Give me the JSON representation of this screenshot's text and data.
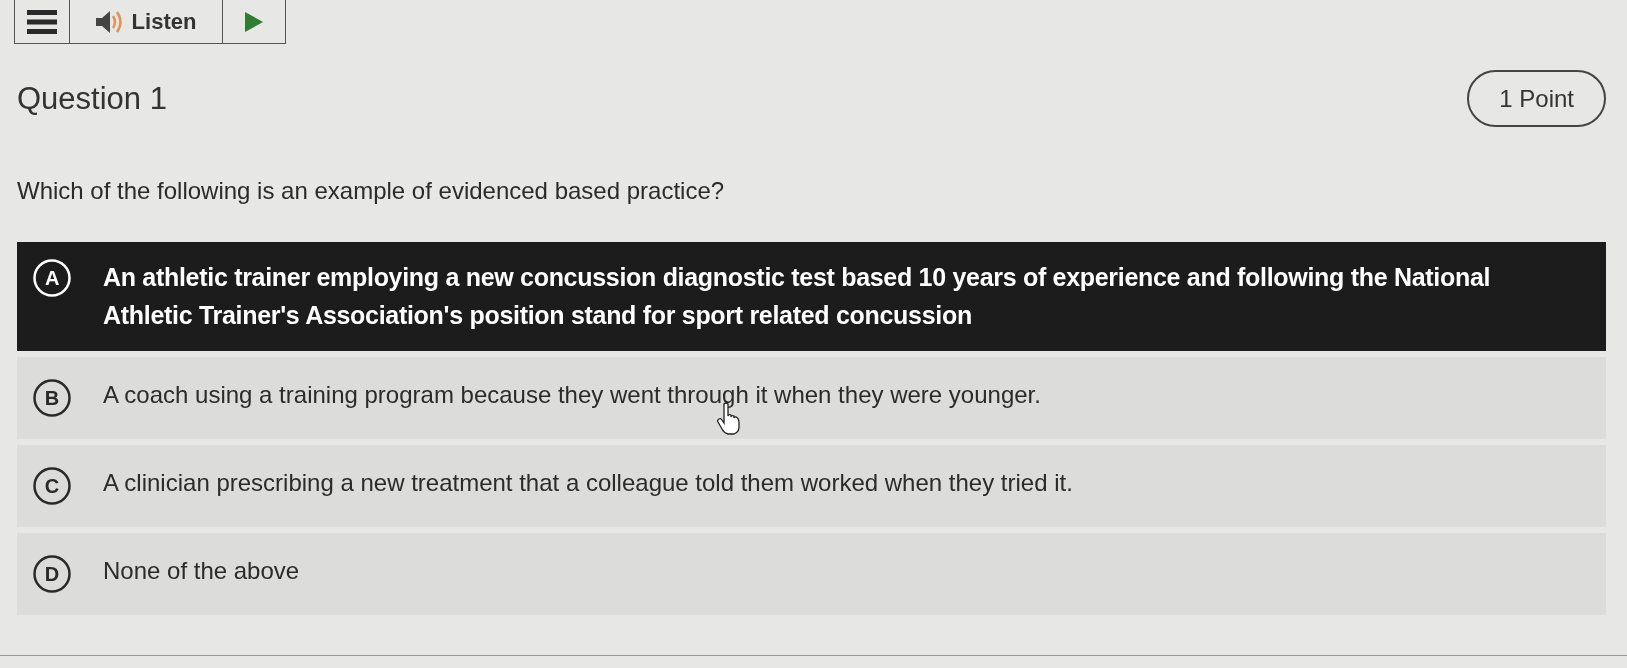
{
  "toolbar": {
    "listen_label": "Listen"
  },
  "question": {
    "title": "Question 1",
    "points": "1 Point",
    "prompt": "Which of the following is an example of evidenced based practice?"
  },
  "options": [
    {
      "letter": "A",
      "text": "An athletic trainer employing a new concussion diagnostic test based 10 years of experience and following the National Athletic Trainer's Association's position stand for sport related concussion",
      "selected": true
    },
    {
      "letter": "B",
      "text": "A coach using a training program because they went through it when they were younger.",
      "selected": false
    },
    {
      "letter": "C",
      "text": "A clinician prescribing a new treatment that a colleague told them worked when they tried it.",
      "selected": false
    },
    {
      "letter": "D",
      "text": "None of the above",
      "selected": false
    }
  ]
}
